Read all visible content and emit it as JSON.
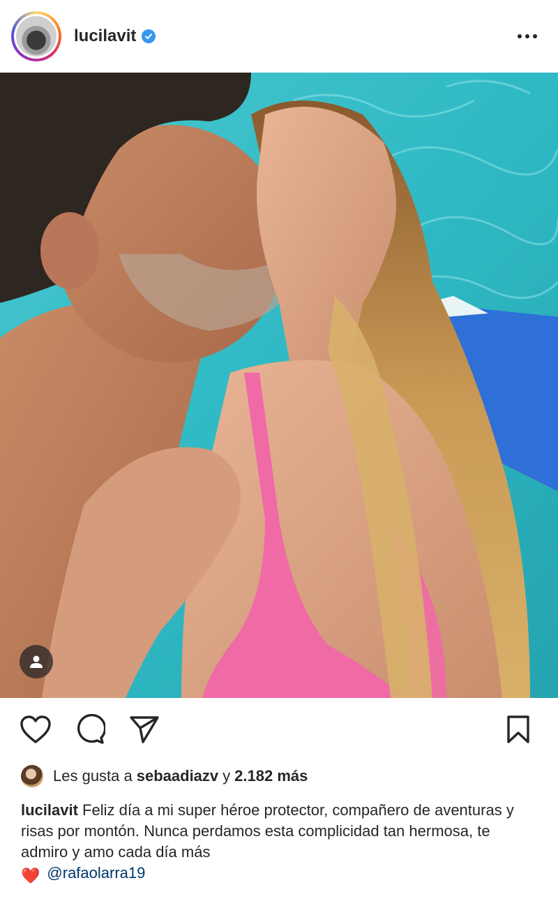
{
  "header": {
    "username": "lucilavit",
    "verified": true,
    "avatar_icon": "profile-avatar",
    "more_icon": "more-horizontal-icon"
  },
  "post": {
    "image_description_icon": "photo",
    "tag_icon": "user-tag-icon"
  },
  "actions": {
    "like_icon": "heart-icon",
    "comment_icon": "comment-icon",
    "share_icon": "send-icon",
    "save_icon": "bookmark-icon"
  },
  "likes": {
    "prefix": "Les gusta a",
    "first_liker": "sebaadiazv",
    "joiner": "y",
    "others": "2.182 más"
  },
  "caption": {
    "username": "lucilavit",
    "text": "Feliz día a mi super héroe protector, compañero de aventuras y risas por montón. Nunca perdamos esta complicidad tan hermosa, te admiro y amo cada día más",
    "emoji": "❤️",
    "mention": "@rafaolarra19"
  },
  "colors": {
    "text": "#262626",
    "verified": "#3897f0",
    "mention": "#00376b",
    "water": "#35c2c9",
    "swimsuit": "#f06aa6"
  }
}
